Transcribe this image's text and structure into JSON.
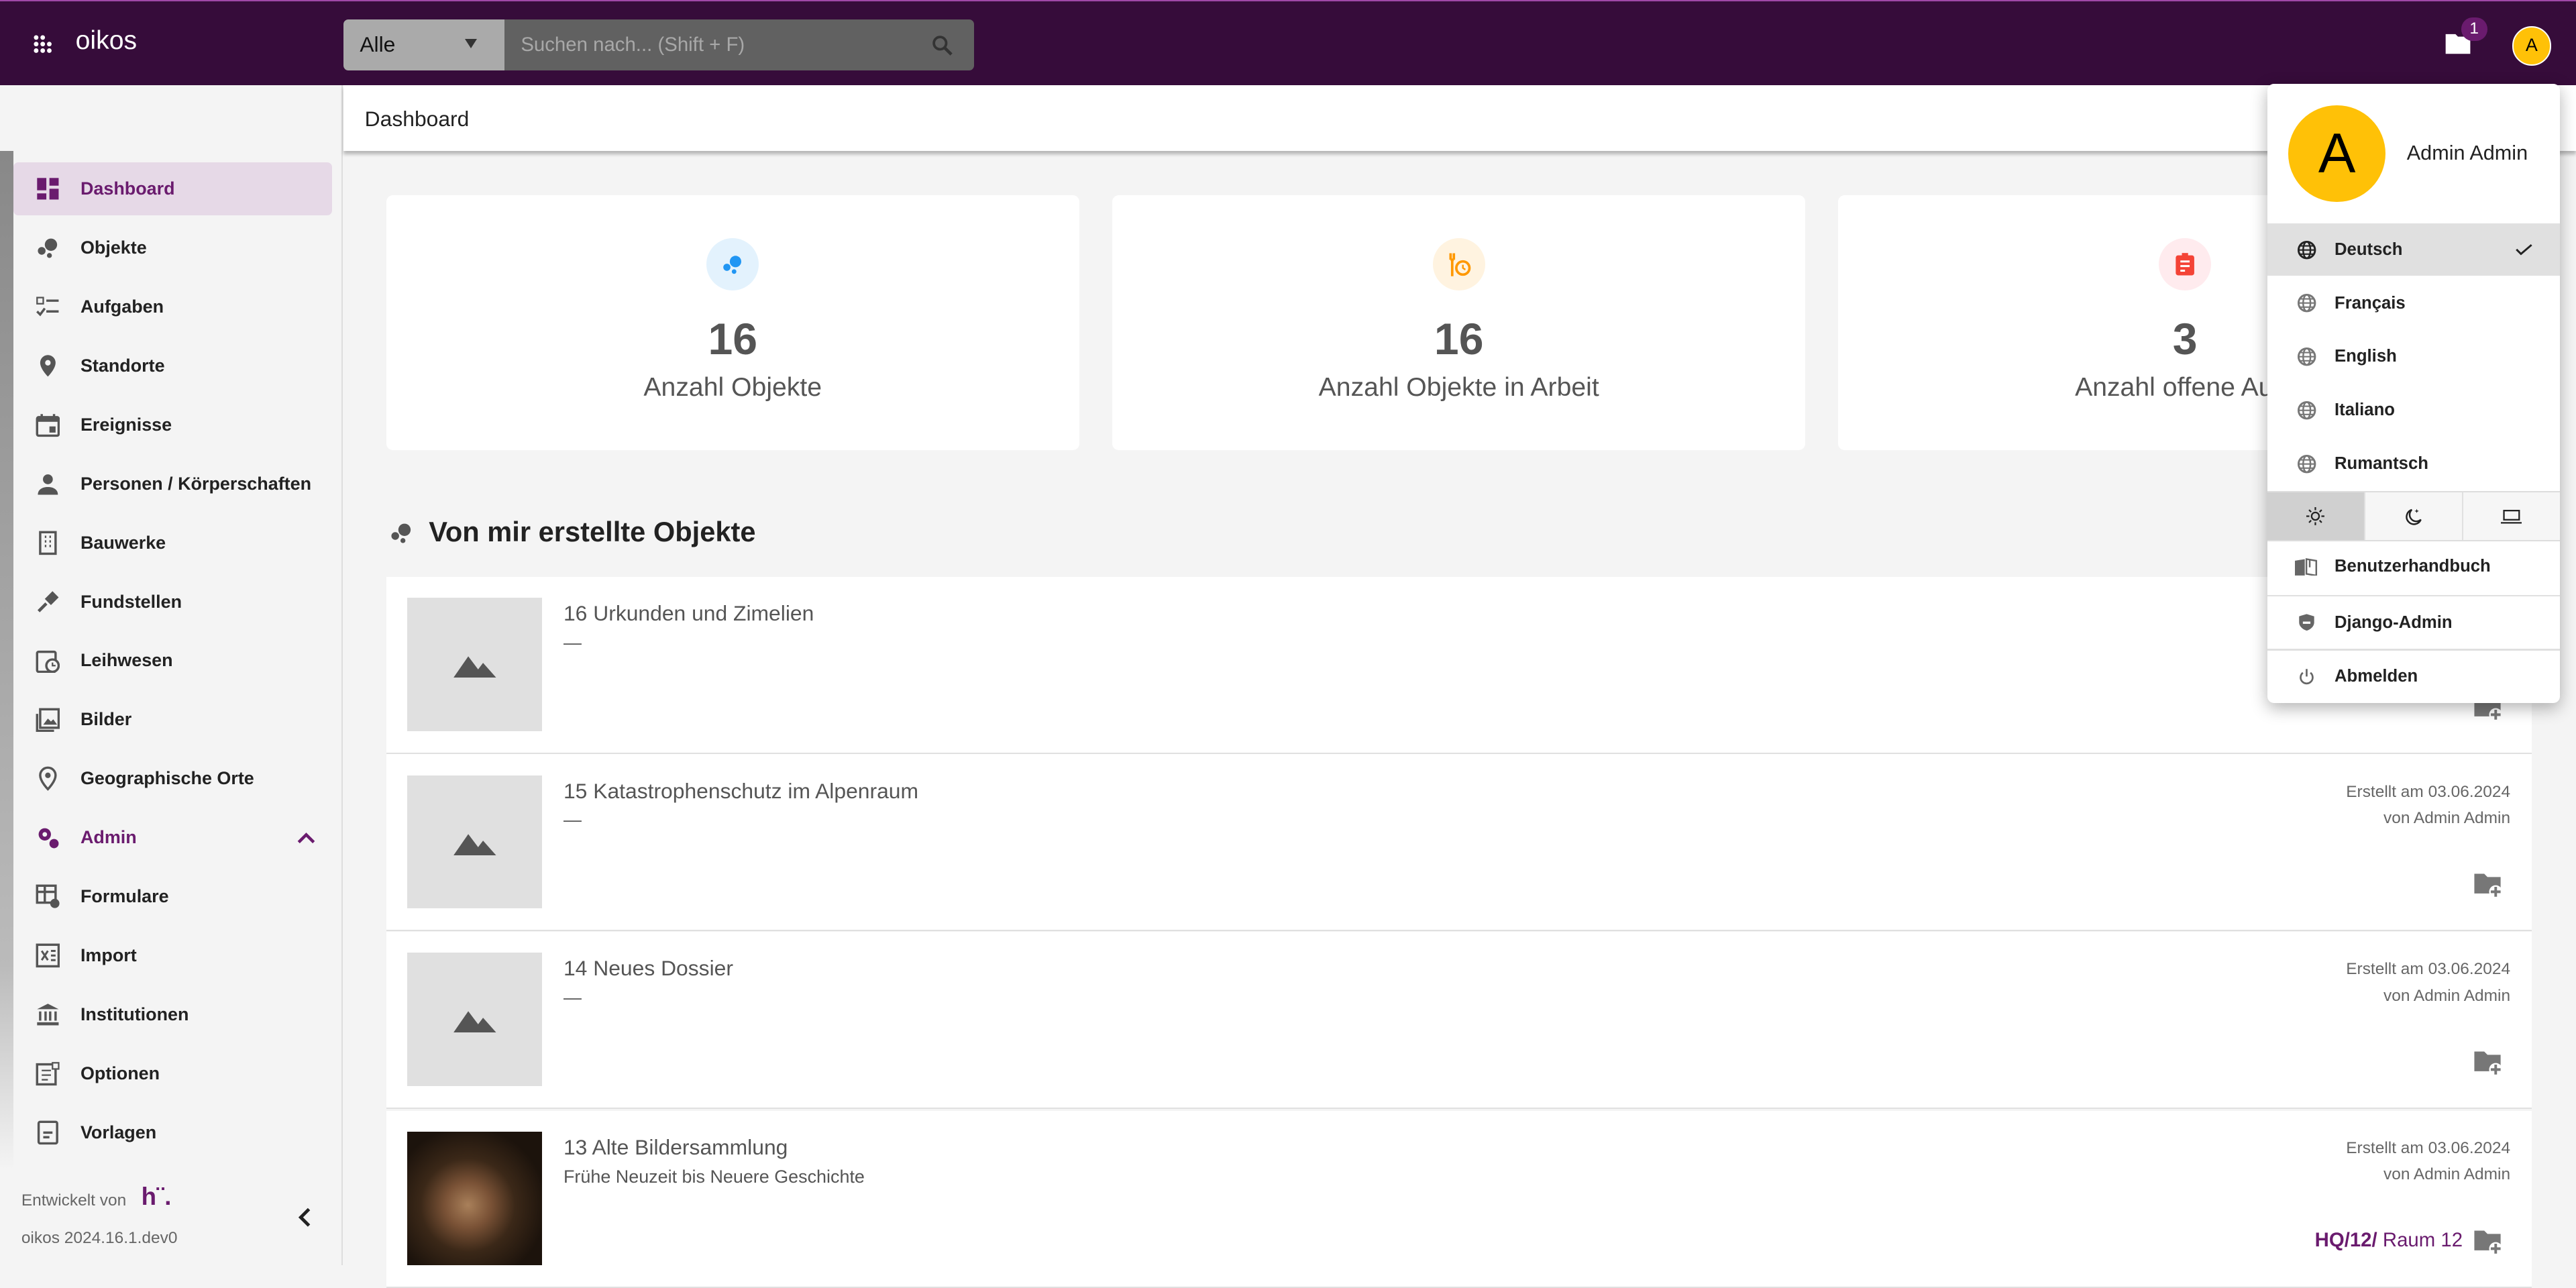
{
  "app": {
    "name": "oikos",
    "accent": "#6a1b6e",
    "topbar_color": "#360c3a"
  },
  "search": {
    "scope": "Alle",
    "placeholder": "Suchen nach... (Shift + F)"
  },
  "topbar": {
    "notification_count": "1",
    "avatar_initial": "A"
  },
  "header": {
    "title": "Dashboard"
  },
  "sidebar": {
    "items": [
      {
        "label": "Dashboard",
        "icon": "dashboard-icon",
        "active": true
      },
      {
        "label": "Objekte",
        "icon": "bubbles-icon"
      },
      {
        "label": "Aufgaben",
        "icon": "checklist-icon"
      },
      {
        "label": "Standorte",
        "icon": "location-pin-icon"
      },
      {
        "label": "Ereignisse",
        "icon": "calendar-icon"
      },
      {
        "label": "Personen / Körperschaften",
        "icon": "person-icon"
      },
      {
        "label": "Bauwerke",
        "icon": "building-icon"
      },
      {
        "label": "Fundstellen",
        "icon": "shovel-icon"
      },
      {
        "label": "Leihwesen",
        "icon": "calendar-clock-icon"
      },
      {
        "label": "Bilder",
        "icon": "image-icon"
      },
      {
        "label": "Geographische Orte",
        "icon": "place-icon"
      },
      {
        "label": "Admin",
        "icon": "cogs-icon",
        "expanded": true
      },
      {
        "label": "Formulare",
        "icon": "form-settings-icon"
      },
      {
        "label": "Import",
        "icon": "excel-icon"
      },
      {
        "label": "Institutionen",
        "icon": "institution-icon"
      },
      {
        "label": "Optionen",
        "icon": "options-icon"
      },
      {
        "label": "Vorlagen",
        "icon": "template-icon"
      }
    ],
    "footer": {
      "developed_by": "Entwickelt von",
      "logo_text": "h¨.",
      "version": "oikos 2024.16.1.dev0"
    }
  },
  "stats": [
    {
      "value": "16",
      "label": "Anzahl Objekte",
      "icon": "bubbles-icon",
      "color": "#2196f3",
      "bg": "#e3f2fd"
    },
    {
      "value": "16",
      "label": "Anzahl Objekte in Arbeit",
      "icon": "tools-clock-icon",
      "color": "#ff9800",
      "bg": "#fff3e0"
    },
    {
      "value": "3",
      "label": "Anzahl offene Aufg",
      "icon": "clipboard-icon",
      "color": "#f44336",
      "bg": "#ffebee"
    }
  ],
  "section": {
    "title": "Von mir erstellte Objekte"
  },
  "objects": [
    {
      "title": "16 Urkunden und Zimelien",
      "subtitle": "—",
      "created": "",
      "by": "",
      "location_bold": "",
      "location": ""
    },
    {
      "title": "15 Katastrophenschutz im Alpenraum",
      "subtitle": "—",
      "created": "Erstellt am 03.06.2024",
      "by": "von Admin Admin",
      "location_bold": "",
      "location": ""
    },
    {
      "title": "14 Neues Dossier",
      "subtitle": "—",
      "created": "Erstellt am 03.06.2024",
      "by": "von Admin Admin",
      "location_bold": "",
      "location": ""
    },
    {
      "title": "13 Alte Bildersammlung",
      "subtitle": "Frühe Neuzeit bis Neuere Geschichte",
      "created": "Erstellt am 03.06.2024",
      "by": "von Admin Admin",
      "location_bold": "HQ/12/",
      "location": " Raum 12"
    }
  ],
  "user_menu": {
    "avatar_initial": "A",
    "name": "Admin Admin",
    "languages": [
      {
        "label": "Deutsch",
        "selected": true
      },
      {
        "label": "Français"
      },
      {
        "label": "English"
      },
      {
        "label": "Italiano"
      },
      {
        "label": "Rumantsch"
      }
    ],
    "theme_selected": "light",
    "themes": [
      "light",
      "dark",
      "system"
    ],
    "manual": "Benutzerhandbuch",
    "django_admin": "Django-Admin",
    "logout": "Abmelden"
  }
}
